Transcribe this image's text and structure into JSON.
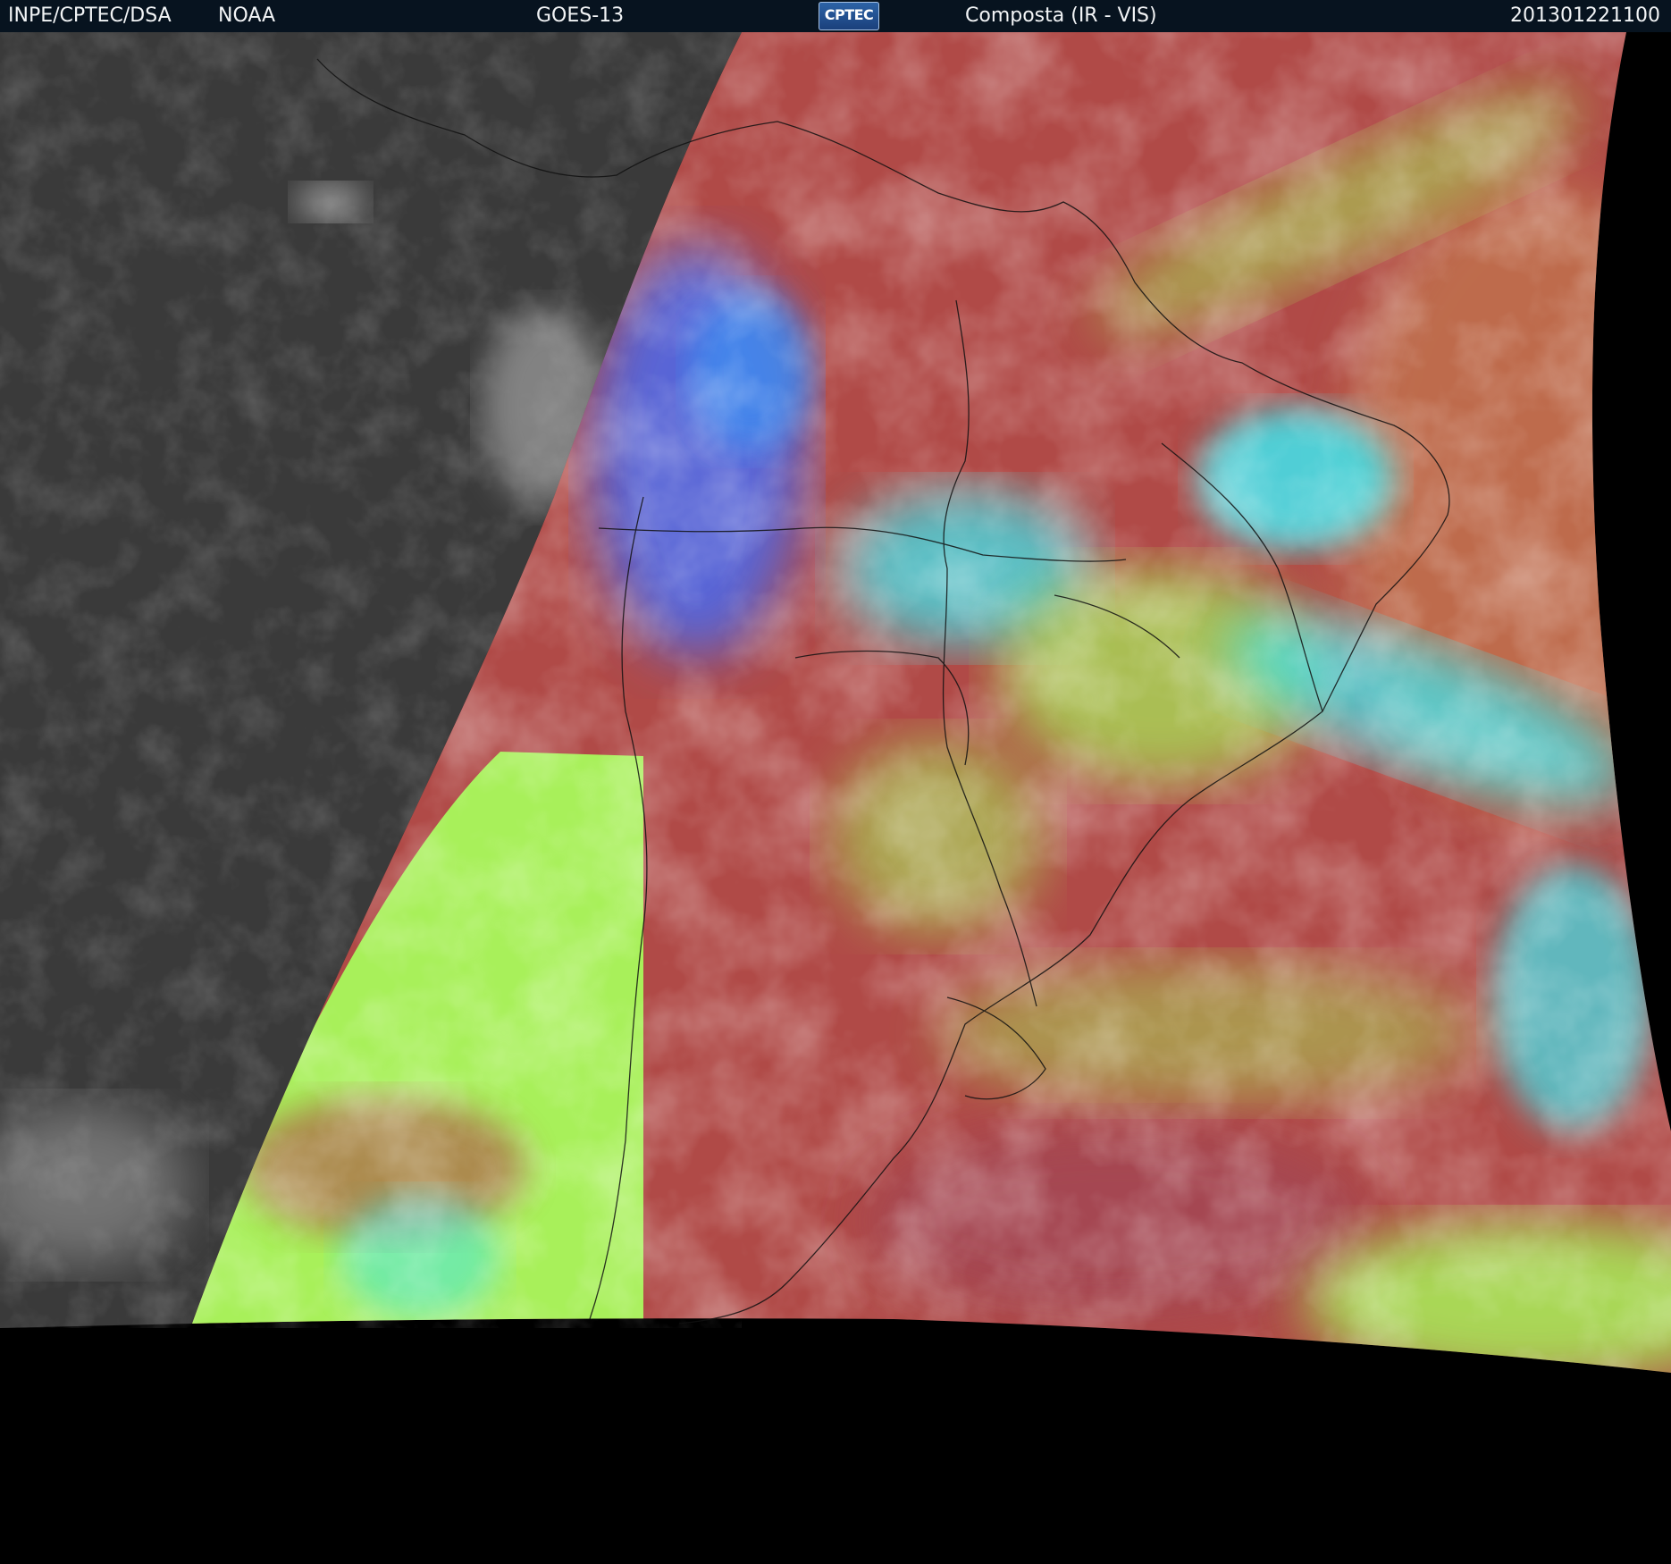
{
  "header": {
    "agency": "INPE/CPTEC/DSA",
    "source": "NOAA",
    "satellite": "GOES-13",
    "logo_text": "CPTEC",
    "product": "Composta (IR - VIS)",
    "timestamp": "201301221100"
  },
  "colors": {
    "header_background": "#07131f",
    "header_text": "#f2f4f6",
    "infrared_grayscale": "#3a3a3a",
    "composite_red": "#b04a47",
    "composite_green": "#a8f05a",
    "composite_cyan": "#3fe6ef",
    "composite_blue": "#4a6bf0",
    "boundary_lines": "#111111",
    "no_data": "#000000"
  },
  "icons": [
    "cptec-logo"
  ]
}
